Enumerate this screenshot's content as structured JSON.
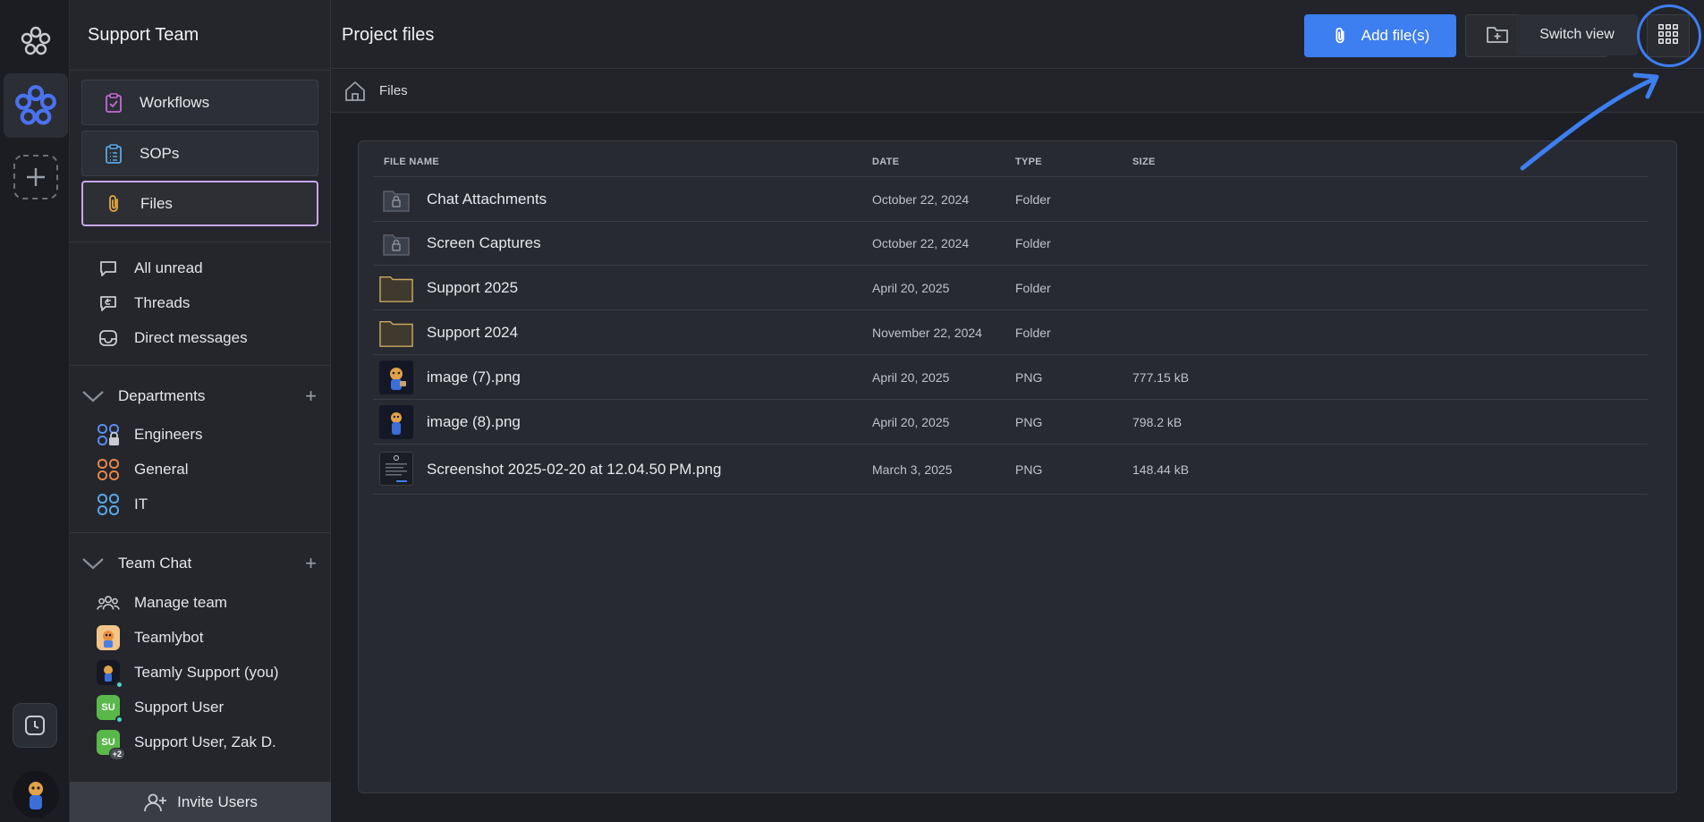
{
  "sidebar": {
    "team_name": "Support Team",
    "nav": [
      {
        "label": "Workflows",
        "icon": "clipboard-check-icon"
      },
      {
        "label": "SOPs",
        "icon": "clipboard-list-icon"
      },
      {
        "label": "Files",
        "icon": "paperclip-icon"
      }
    ],
    "inbox": [
      {
        "label": "All unread",
        "icon": "chat-bubble-icon"
      },
      {
        "label": "Threads",
        "icon": "reply-icon"
      },
      {
        "label": "Direct messages",
        "icon": "inbox-icon"
      }
    ],
    "departments": {
      "title": "Departments",
      "items": [
        {
          "label": "Engineers",
          "color": "#5b8cf0"
        },
        {
          "label": "General",
          "color": "#e8864a"
        },
        {
          "label": "IT",
          "color": "#5aa9e6"
        }
      ]
    },
    "team_chat": {
      "title": "Team Chat",
      "items": [
        {
          "label": "Manage team"
        },
        {
          "label": "Teamlybot"
        },
        {
          "label": "Teamly Support (you)"
        },
        {
          "label": "Support User",
          "initials": "SU"
        },
        {
          "label": "Support User, Zak D.",
          "initials": "SU",
          "badge": "+2"
        }
      ]
    },
    "invite_label": "Invite Users"
  },
  "header": {
    "title": "Project files",
    "add_label": "Add file(s)",
    "tooltip": "Switch view"
  },
  "breadcrumb": {
    "label": "Files"
  },
  "table": {
    "columns": [
      "FILE NAME",
      "DATE",
      "TYPE",
      "SIZE"
    ],
    "rows": [
      {
        "name": "Chat Attachments",
        "date": "October 22, 2024",
        "type": "Folder",
        "size": "",
        "kind": "locked-folder"
      },
      {
        "name": "Screen Captures",
        "date": "October 22, 2024",
        "type": "Folder",
        "size": "",
        "kind": "locked-folder"
      },
      {
        "name": "Support 2025",
        "date": "April 20, 2025",
        "type": "Folder",
        "size": "",
        "kind": "folder"
      },
      {
        "name": "Support 2024",
        "date": "November 22, 2024",
        "type": "Folder",
        "size": "",
        "kind": "folder"
      },
      {
        "name": "image (7).png",
        "date": "April 20, 2025",
        "type": "PNG",
        "size": "777.15 kB",
        "kind": "image"
      },
      {
        "name": "image (8).png",
        "date": "April 20, 2025",
        "type": "PNG",
        "size": "798.2 kB",
        "kind": "image"
      },
      {
        "name": "Screenshot 2025-02-20 at 12.04.50 PM.png",
        "date": "March 3, 2025",
        "type": "PNG",
        "size": "148.44 kB",
        "kind": "screenshot"
      }
    ]
  },
  "colors": {
    "accent": "#3d7ef0",
    "active_border": "#c9a6f0",
    "online": "#4dd2c6",
    "avatar_green": "#5ab84a"
  }
}
